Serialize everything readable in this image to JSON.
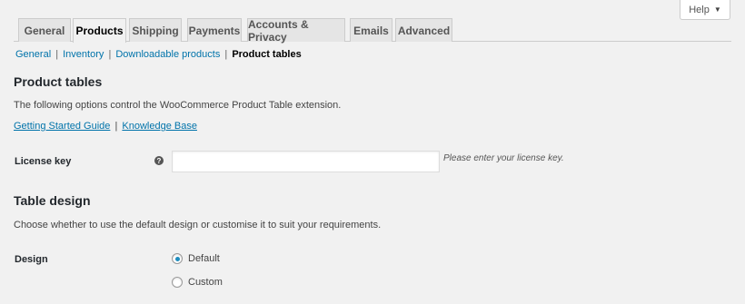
{
  "help_tab": {
    "label": "Help",
    "arrow": "▼"
  },
  "tabs": [
    {
      "label": "General",
      "active": false
    },
    {
      "label": "Products",
      "active": true
    },
    {
      "label": "Shipping",
      "active": false
    },
    {
      "label": "Payments",
      "active": false
    },
    {
      "label": "Accounts & Privacy",
      "active": false
    },
    {
      "label": "Emails",
      "active": false
    },
    {
      "label": "Advanced",
      "active": false
    }
  ],
  "subnav": {
    "items": [
      "General",
      "Inventory",
      "Downloadable products",
      "Product tables"
    ],
    "separator": "|",
    "current": "Product tables"
  },
  "product_tables": {
    "heading": "Product tables",
    "description": "The following options control the WooCommerce Product Table extension.",
    "links": [
      "Getting Started Guide",
      "Knowledge Base"
    ],
    "link_separator": "|"
  },
  "license": {
    "label": "License key",
    "tip_icon": "question-tip-icon",
    "tip_glyph": "?",
    "value": "",
    "hint": "Please enter your license key."
  },
  "table_design": {
    "heading": "Table design",
    "description": "Choose whether to use the default design or customise it to suit your requirements."
  },
  "design": {
    "label": "Design",
    "options": [
      {
        "label": "Default",
        "checked": true
      },
      {
        "label": "Custom",
        "checked": false
      }
    ]
  },
  "colors": {
    "background": "#f1f1f1",
    "link": "#0073aa",
    "radio_checked": "#1e8cbe",
    "tab_inactive": "#e5e5e5"
  }
}
